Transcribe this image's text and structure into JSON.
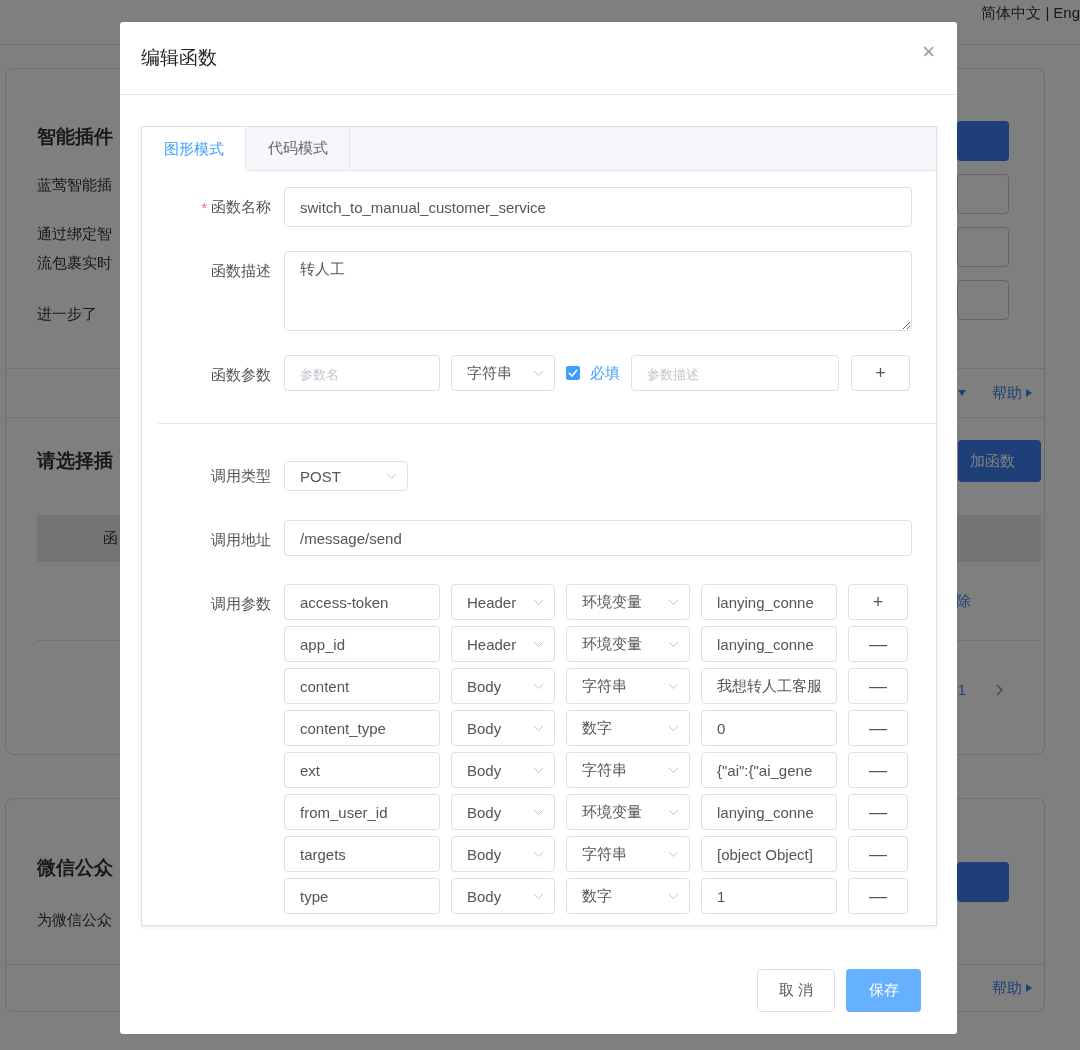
{
  "languages": {
    "items": [
      "简体中文",
      "Eng"
    ],
    "separator": "|"
  },
  "background": {
    "plugin_card": {
      "title": "智能插件",
      "lines": [
        "蓝莺智能插",
        "通过绑定智",
        "流包裹实时",
        "进一步了"
      ],
      "help_link": "帮助",
      "section_title": "请选择插",
      "add_button": "加函数",
      "table_header": "函",
      "row_action": "除",
      "page_number": "1"
    },
    "wechat_card": {
      "title": "微信公众",
      "description": "为微信公众",
      "help_link": "帮助"
    }
  },
  "dialog": {
    "title": "编辑函数",
    "close": "×",
    "tabs": [
      {
        "label": "图形模式",
        "selected": true
      },
      {
        "label": "代码模式",
        "selected": false
      }
    ],
    "fields": {
      "name_label": "函数名称",
      "name_required": true,
      "required_mark": "*",
      "name": "switch_to_manual_customer_service",
      "description_label": "函数描述",
      "description": "转人工"
    },
    "function_param": {
      "label": "函数参数",
      "name_placeholder": "参数名",
      "type": "字符串",
      "required": true,
      "required_label": "必填",
      "description_placeholder": "参数描述",
      "add": "+"
    },
    "call": {
      "type_label": "调用类型",
      "type": "POST",
      "url_label": "调用地址",
      "url": "/message/send",
      "params_label": "调用参数"
    },
    "call_params": [
      {
        "name": "access-token",
        "location": "Header",
        "type": "环境变量",
        "value": "lanying_conne",
        "action": "+"
      },
      {
        "name": "app_id",
        "location": "Header",
        "type": "环境变量",
        "value": "lanying_conne",
        "action": "—"
      },
      {
        "name": "content",
        "location": "Body",
        "type": "字符串",
        "value": "我想转人工客服",
        "action": "—"
      },
      {
        "name": "content_type",
        "location": "Body",
        "type": "数字",
        "value": "0",
        "action": "—"
      },
      {
        "name": "ext",
        "location": "Body",
        "type": "字符串",
        "value": "{\"ai\":{\"ai_gene",
        "action": "—"
      },
      {
        "name": "from_user_id",
        "location": "Body",
        "type": "环境变量",
        "value": "lanying_conne",
        "action": "—"
      },
      {
        "name": "targets",
        "location": "Body",
        "type": "字符串",
        "value": "[object Object]",
        "action": "—"
      },
      {
        "name": "type",
        "location": "Body",
        "type": "数字",
        "value": "1",
        "action": "—"
      }
    ],
    "buttons": {
      "cancel": "取 消",
      "save": "保存"
    }
  }
}
